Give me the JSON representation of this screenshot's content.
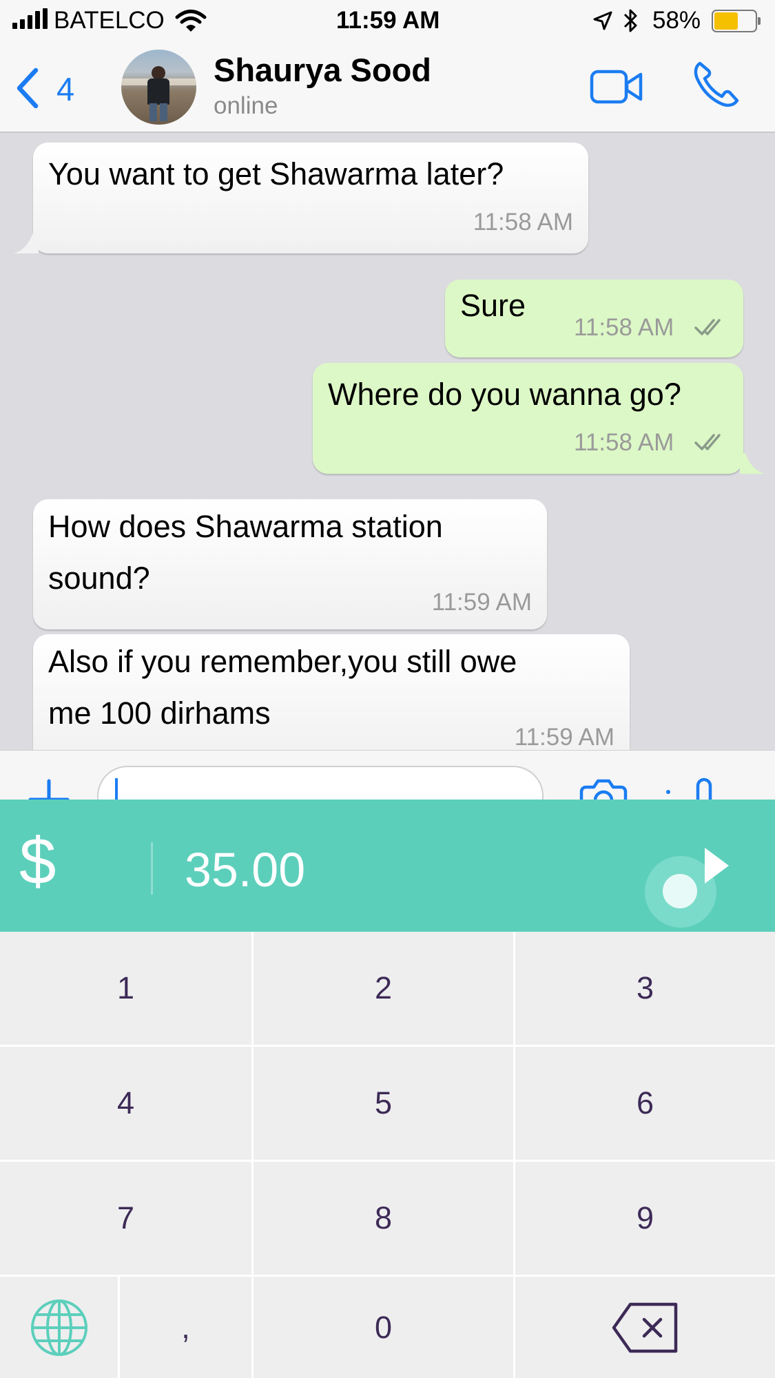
{
  "status_bar": {
    "carrier": "BATELCO",
    "time": "11:59 AM",
    "battery_percent": "58%",
    "battery_level": 0.58,
    "icons": [
      "signal-bars-icon",
      "wifi-icon",
      "location-arrow-icon",
      "bluetooth-icon",
      "battery-icon"
    ]
  },
  "header": {
    "back_count": "4",
    "contact_name": "Shaurya Sood",
    "contact_status": "online",
    "icons": [
      "back-chevron-icon",
      "avatar",
      "video-call-icon",
      "phone-call-icon"
    ],
    "accent_color": "#1b7cf2"
  },
  "messages": [
    {
      "direction": "incoming",
      "text": "You want to get Shawarma later?",
      "time": "11:58 AM"
    },
    {
      "direction": "outgoing",
      "text": "Sure",
      "time": "11:58 AM",
      "read": true
    },
    {
      "direction": "outgoing",
      "text": "Where do you wanna go?",
      "time": "11:58 AM",
      "read": true
    },
    {
      "direction": "incoming",
      "text": "How does Shawarma station\nsound?",
      "time": "11:59 AM"
    },
    {
      "direction": "incoming",
      "text": "Also if you remember,you still owe\nme 100 dirhams",
      "time": "11:59 AM"
    }
  ],
  "input_bar": {
    "value": "",
    "icons": [
      "plus-icon",
      "camera-icon",
      "microphone-icon"
    ]
  },
  "payment_keyboard": {
    "currency_symbol": "$",
    "amount": "35.00",
    "bar_color": "#5ccfbb",
    "icons": [
      "send-arrow-icon",
      "globe-icon",
      "backspace-icon"
    ],
    "keys": {
      "k1": "1",
      "k2": "2",
      "k3": "3",
      "k4": "4",
      "k5": "5",
      "k6": "6",
      "k7": "7",
      "k8": "8",
      "k9": "9",
      "comma": ",",
      "k0": "0"
    }
  }
}
